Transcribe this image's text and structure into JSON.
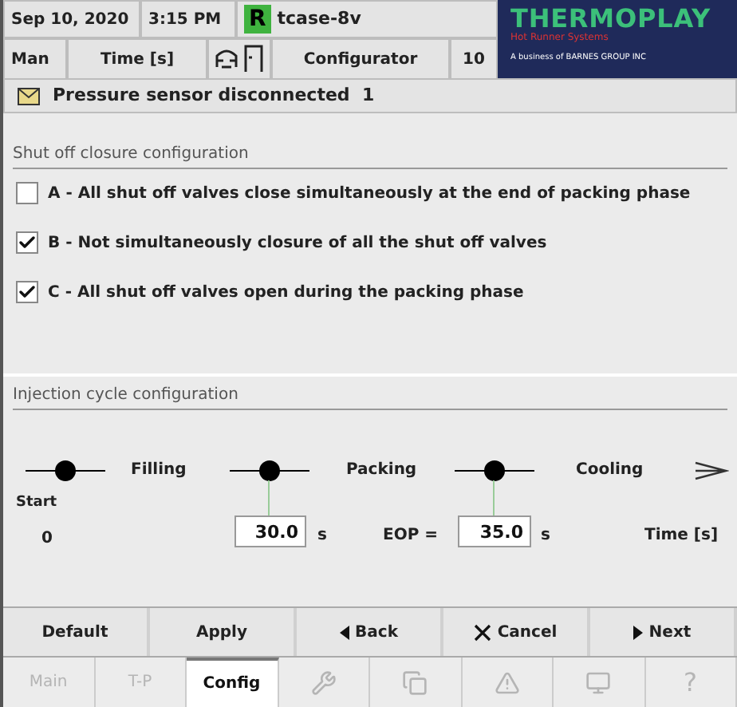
{
  "header": {
    "date": "Sep 10, 2020",
    "time": "3:15 PM",
    "run_indicator": "R",
    "recipe": "tcase-8v",
    "mode": "Man",
    "unit": "Time [s]",
    "screen": "Configurator",
    "number": "10",
    "logo": {
      "title": "THERMOPLAY",
      "subtitle": "Hot Runner Systems",
      "tagline": "A business of BARNES GROUP INC"
    }
  },
  "alert": {
    "text": "Pressure sensor disconnected  1"
  },
  "shutoff": {
    "title": "Shut off closure configuration",
    "options": [
      {
        "text": "A - All shut off valves close simultaneously at the end of packing phase",
        "checked": false
      },
      {
        "text": "B - Not simultaneously closure of all the shut off valves",
        "checked": true
      },
      {
        "text": "C - All shut off valves open during the packing phase",
        "checked": true
      }
    ]
  },
  "cycle": {
    "title": "Injection cycle configuration",
    "phases": [
      "Filling",
      "Packing",
      "Cooling"
    ],
    "start_label": "Start",
    "start_value": "0",
    "packing_time": {
      "value": "30.0",
      "unit": "s"
    },
    "eop": {
      "label": "EOP =",
      "value": "35.0",
      "unit": "s"
    },
    "axis_label": "Time [s]"
  },
  "buttons": [
    {
      "label": "Default",
      "kind": "plain"
    },
    {
      "label": "Apply",
      "kind": "plain"
    },
    {
      "label": "Back",
      "kind": "back"
    },
    {
      "label": "Cancel",
      "kind": "cancel"
    },
    {
      "label": "Next",
      "kind": "next"
    }
  ],
  "tabs": [
    {
      "kind": "text",
      "label": "Main",
      "selected": false,
      "disabled": true
    },
    {
      "kind": "text",
      "label": "T-P",
      "selected": false,
      "disabled": true
    },
    {
      "kind": "text",
      "label": "Config",
      "selected": true,
      "disabled": false
    },
    {
      "kind": "wrench",
      "selected": false,
      "disabled": true
    },
    {
      "kind": "windows",
      "selected": false,
      "disabled": true
    },
    {
      "kind": "warning",
      "selected": false,
      "disabled": true
    },
    {
      "kind": "monitor",
      "selected": false,
      "disabled": true
    },
    {
      "kind": "text",
      "label": "?",
      "selected": false,
      "disabled": true
    }
  ]
}
